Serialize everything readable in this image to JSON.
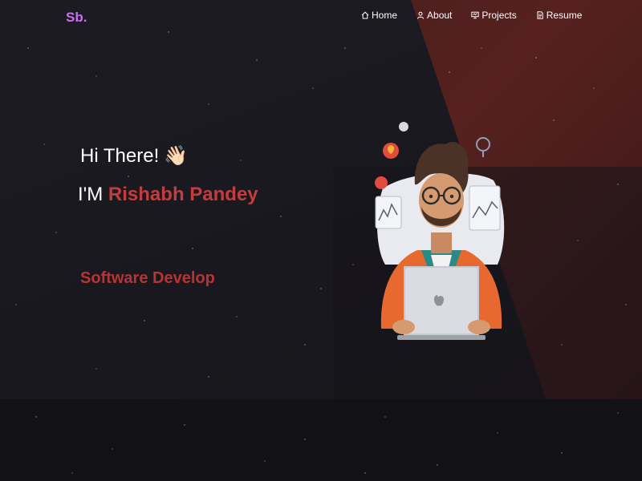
{
  "brand": {
    "logo_text": "Sb."
  },
  "nav": {
    "items": [
      {
        "label": "Home",
        "icon": "home-icon"
      },
      {
        "label": "About",
        "icon": "user-icon"
      },
      {
        "label": "Projects",
        "icon": "projects-icon"
      },
      {
        "label": "Resume",
        "icon": "document-icon"
      }
    ]
  },
  "hero": {
    "greeting": "Hi There!",
    "wave_emoji": "👋🏻",
    "intro_prefix": "I'M",
    "name": "Rishabh Pandey",
    "typed_text": "Software Develop"
  },
  "colors": {
    "brand_purple": "#c770f0",
    "accent_red": "#c63b3b",
    "bg_dark": "#18171c",
    "bg_red": "#56211f"
  }
}
